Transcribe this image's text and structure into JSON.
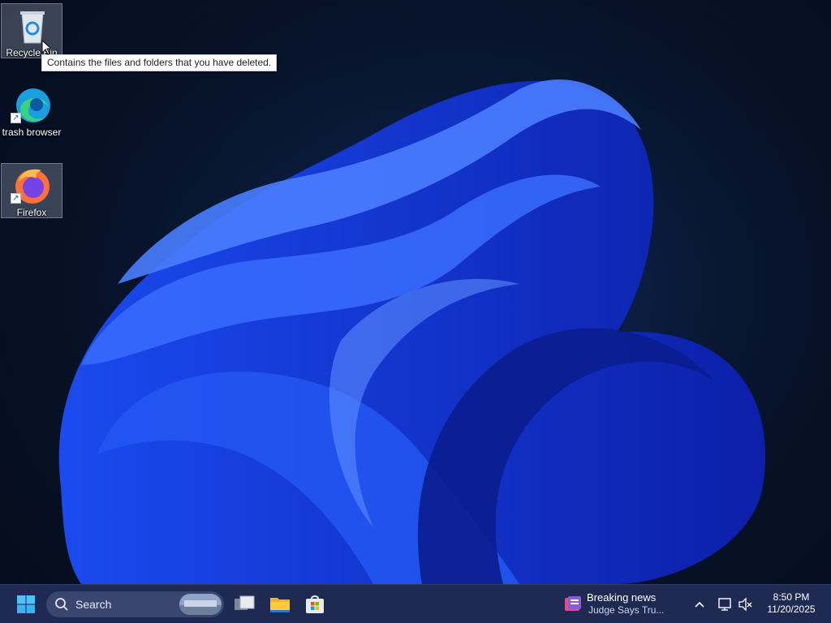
{
  "desktop": {
    "icons": [
      {
        "label": "Recycle Bin",
        "icon": "recycle-bin-icon"
      },
      {
        "label": "trash browser",
        "icon": "edge-icon"
      },
      {
        "label": "Firefox",
        "icon": "firefox-icon"
      }
    ],
    "tooltip": "Contains the files and folders that you have deleted."
  },
  "taskbar": {
    "search_label": "Search",
    "apps": [
      "start-icon",
      "task-view-icon",
      "file-explorer-icon",
      "microsoft-store-icon"
    ],
    "news": {
      "title": "Breaking news",
      "headline": "Judge Says Tru..."
    },
    "clock": {
      "time": "8:50 PM",
      "date": "11/20/2025"
    }
  },
  "colors": {
    "taskbar": "#1e2a52",
    "accent": "#2f6bff",
    "wallpaper_bg": "#08162f"
  }
}
